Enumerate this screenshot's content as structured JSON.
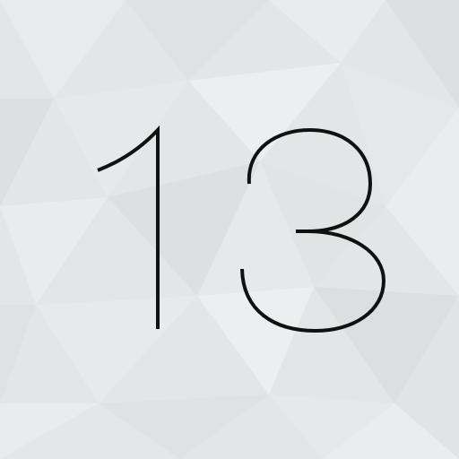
{
  "app_icon": {
    "number_text": "13",
    "colors": {
      "background": "#e3e5e6",
      "facet_light": "#eceeef",
      "facet_dark": "#d8dbdc",
      "glyph": "#111111"
    },
    "background_style": "low-poly faceted light gray"
  }
}
